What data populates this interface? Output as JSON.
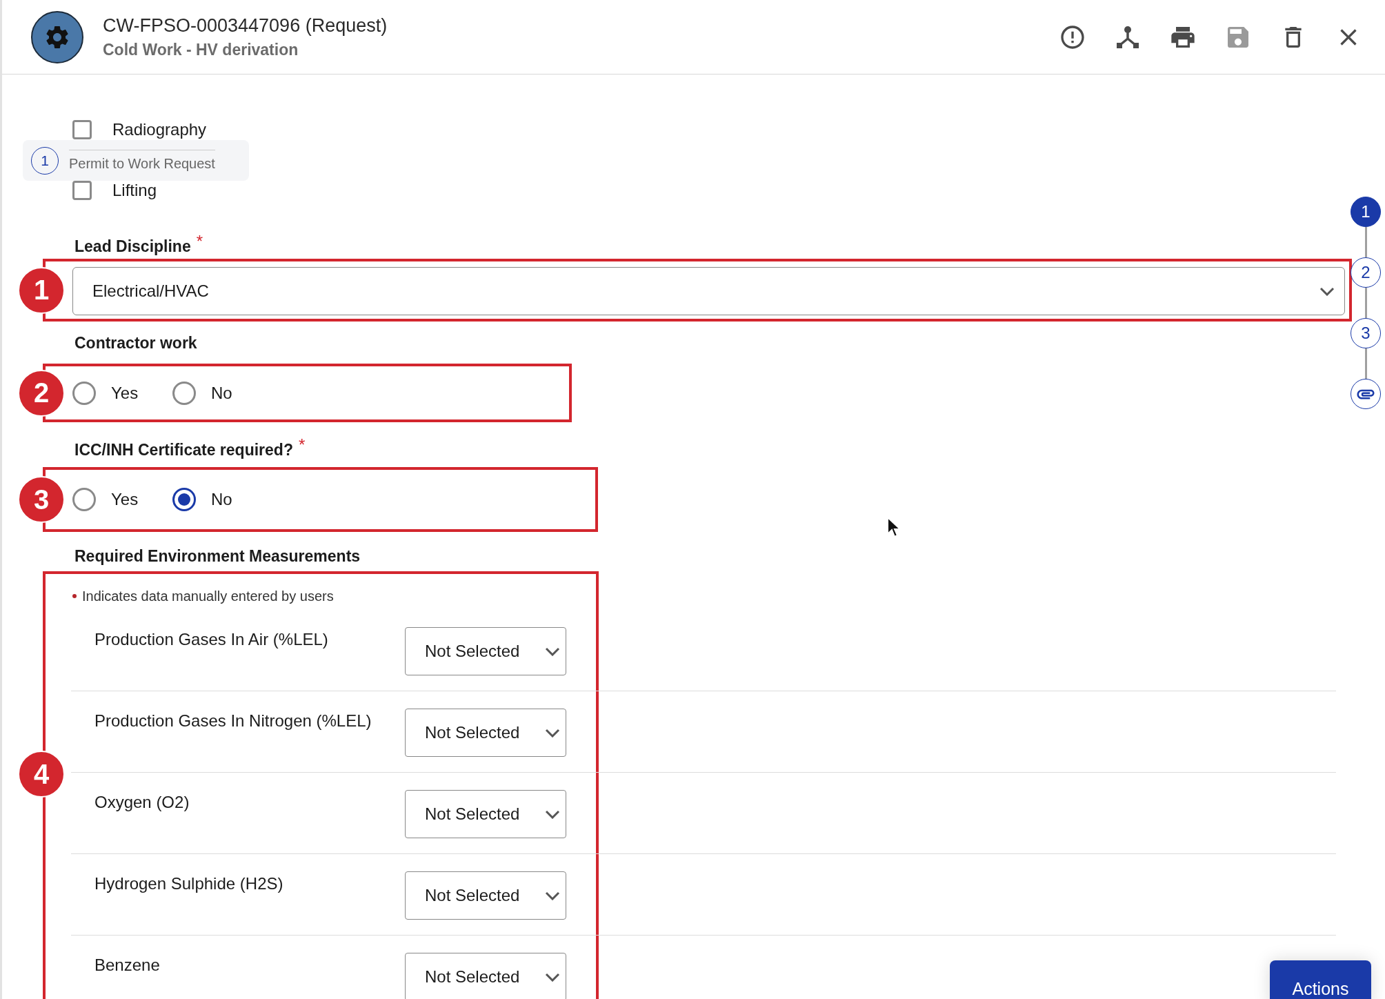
{
  "header": {
    "title": "CW-FPSO-0003447096 (Request)",
    "subtitle": "Cold Work - HV derivation"
  },
  "toolbar": [
    {
      "kind": "alert",
      "disabled": false
    },
    {
      "kind": "hub",
      "disabled": false
    },
    {
      "kind": "print",
      "disabled": false
    },
    {
      "kind": "save",
      "disabled": true
    },
    {
      "kind": "delete",
      "disabled": false
    },
    {
      "kind": "close",
      "disabled": false
    }
  ],
  "work_types": [
    {
      "label": "Radiography",
      "checked": false
    },
    {
      "label": "Lifting",
      "checked": false
    }
  ],
  "tooltip": {
    "number": "1",
    "text": "Permit to Work Request"
  },
  "lead_discipline": {
    "annotation": "1",
    "label": "Lead Discipline",
    "required_mark": "*",
    "value": "Electrical/HVAC"
  },
  "contractor_work": {
    "annotation": "2",
    "label": "Contractor work",
    "options": [
      {
        "label": "Yes",
        "selected": false
      },
      {
        "label": "No",
        "selected": false
      }
    ]
  },
  "certificate": {
    "annotation": "3",
    "label": "ICC/INH Certificate required?",
    "required_mark": "*",
    "options": [
      {
        "label": "Yes",
        "selected": false
      },
      {
        "label": "No",
        "selected": true
      }
    ]
  },
  "measurements": {
    "annotation": "4",
    "title": "Required Environment Measurements",
    "note": "Indicates data manually entered by users",
    "rows": [
      {
        "label": "Production Gases In Air (%LEL)",
        "value": "Not Selected"
      },
      {
        "label": "Production Gases In Nitrogen (%LEL)",
        "value": "Not Selected"
      },
      {
        "label": "Oxygen (O2)",
        "value": "Not Selected"
      },
      {
        "label": "Hydrogen Sulphide (H2S)",
        "value": "Not Selected"
      },
      {
        "label": "Benzene",
        "value": "Not Selected"
      }
    ]
  },
  "stepper": [
    {
      "kind": "step",
      "label": "1",
      "selected": true
    },
    {
      "kind": "step",
      "label": "2",
      "selected": false
    },
    {
      "kind": "step",
      "label": "3",
      "selected": false
    },
    {
      "kind": "attachment",
      "selected": false
    }
  ],
  "actions_button": "Actions"
}
